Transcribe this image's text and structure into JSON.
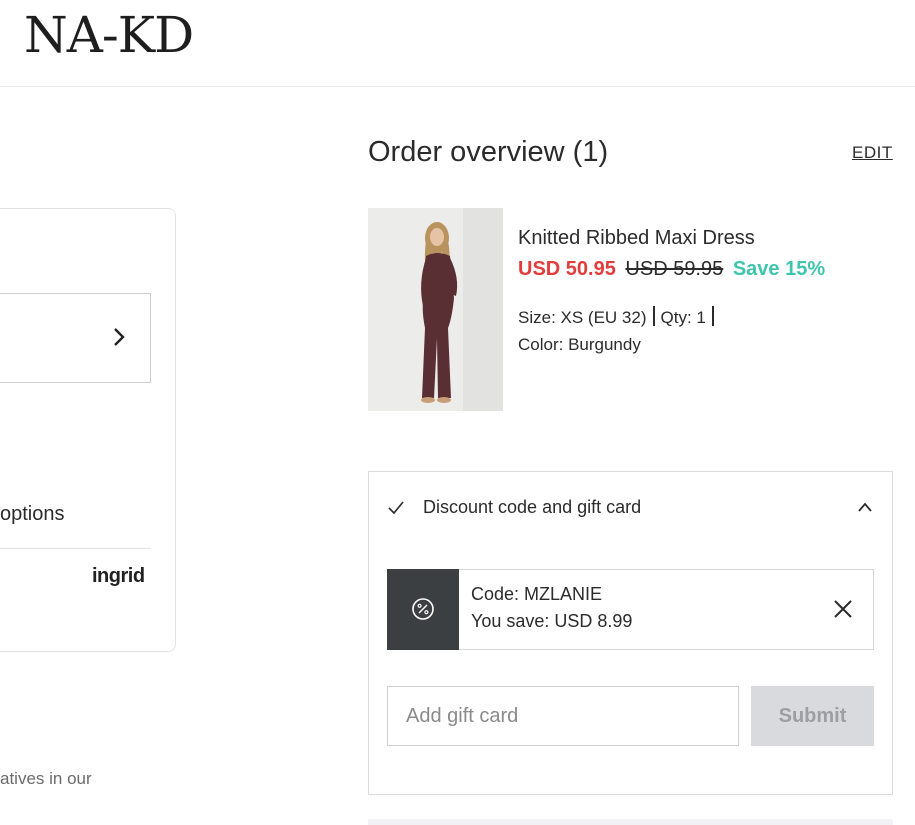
{
  "header": {
    "logo": "NA-KD"
  },
  "left": {
    "options_text": "options",
    "ingrid_logo": "ingrid",
    "bottom_text": "atives in our"
  },
  "order": {
    "title": "Order overview (1)",
    "edit_label": "EDIT",
    "product": {
      "name": "Knitted Ribbed Maxi Dress",
      "price_sale": "USD 50.95",
      "price_original": "USD 59.95",
      "save_text": "Save 15%",
      "size": "Size: XS (EU 32)",
      "qty": "Qty: 1",
      "color": "Color: Burgundy",
      "image_icon": "product-photo-dress"
    }
  },
  "discount": {
    "title": "Discount code and gift card",
    "code": "Code: MZLANIE",
    "you_save": "You save: USD 8.99",
    "gift_placeholder": "Add gift card",
    "gift_value": "",
    "submit_label": "Submit"
  },
  "colors": {
    "sale": "#e23d3d",
    "save": "#3fc4ae",
    "code_block": "#3b3f41",
    "submit_disabled_bg": "#d8dadd"
  }
}
